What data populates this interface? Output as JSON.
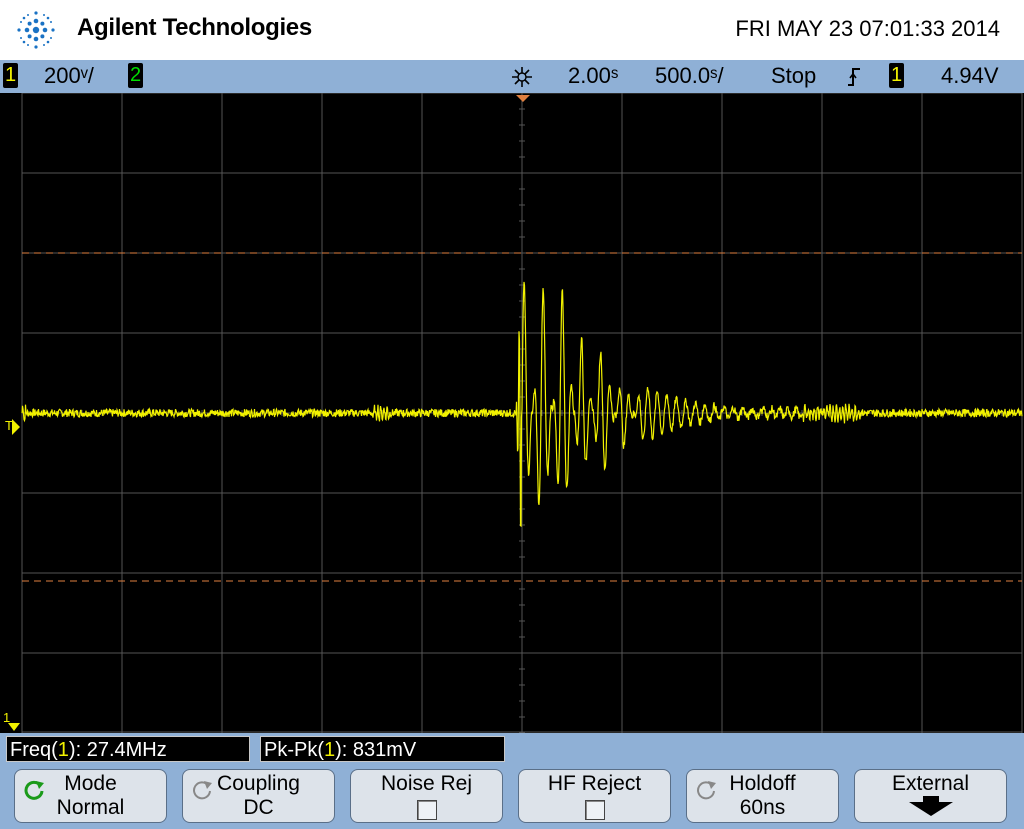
{
  "header": {
    "brand": "Agilent Technologies",
    "datetime": "FRI MAY 23 07:01:33 2014"
  },
  "status": {
    "ch1_label": "1",
    "ch1_scale": "200ᵛ/",
    "ch2_label": "2",
    "delay": "2.00ˢ",
    "timebase": "500.0ˢ/",
    "run_state": "Stop",
    "trigger_source": "1",
    "trigger_level": "4.94V"
  },
  "markers": {
    "trigger": "T",
    "ch1_ground": "1"
  },
  "measurements": {
    "freq": {
      "prefix": "Freq(",
      "ch": "1",
      "suffix": "): 27.4MHz"
    },
    "pkpk": {
      "prefix": "Pk-Pk(",
      "ch": "1",
      "suffix": "): 831mV"
    }
  },
  "softkeys": {
    "mode": {
      "line1": "Mode",
      "line2": "Normal"
    },
    "coupling": {
      "line1": "Coupling",
      "line2": "DC"
    },
    "noise_rej": {
      "line1": "Noise Rej"
    },
    "hf_reject": {
      "line1": "HF Reject"
    },
    "holdoff": {
      "line1": "Holdoff",
      "line2": "60ns"
    },
    "external": {
      "line1": "External"
    }
  },
  "colors": {
    "trace": "#f2f200",
    "grid": "#555555",
    "cursor": "#e08040",
    "chrome": "#8fb0d6"
  },
  "chart_data": {
    "type": "line",
    "x_unit": "s",
    "y_unit": "V",
    "x_range": [
      -0.0025,
      0.0025
    ],
    "y_range": [
      -0.8,
      0.8
    ],
    "timebase_per_div": 0.0005,
    "volts_per_div": 0.2,
    "cursor_levels": [
      0.4,
      -0.42
    ],
    "series": [
      {
        "points": [
          [
            -0.0025,
            0.0
          ],
          [
            -0.0008,
            0.0
          ],
          [
            -0.0007,
            0.02
          ],
          [
            -0.00062,
            0.0
          ],
          [
            -0.00045,
            0.01
          ],
          [
            -0.0003,
            0.0
          ],
          [
            -3e-05,
            0.0
          ],
          [
            0.0,
            0.41
          ],
          [
            0.0001,
            -0.35
          ],
          [
            0.0002,
            0.32
          ],
          [
            0.0003,
            -0.2
          ],
          [
            0.0004,
            0.18
          ],
          [
            0.0005,
            -0.1
          ],
          [
            0.0006,
            0.07
          ],
          [
            0.0008,
            0.03
          ],
          [
            0.001,
            0.015
          ],
          [
            0.0013,
            0.005
          ],
          [
            0.00135,
            0.02
          ],
          [
            0.0015,
            0.01
          ],
          [
            0.0016,
            0.02
          ],
          [
            0.0018,
            0.0
          ],
          [
            0.0025,
            0.0
          ]
        ]
      }
    ]
  }
}
